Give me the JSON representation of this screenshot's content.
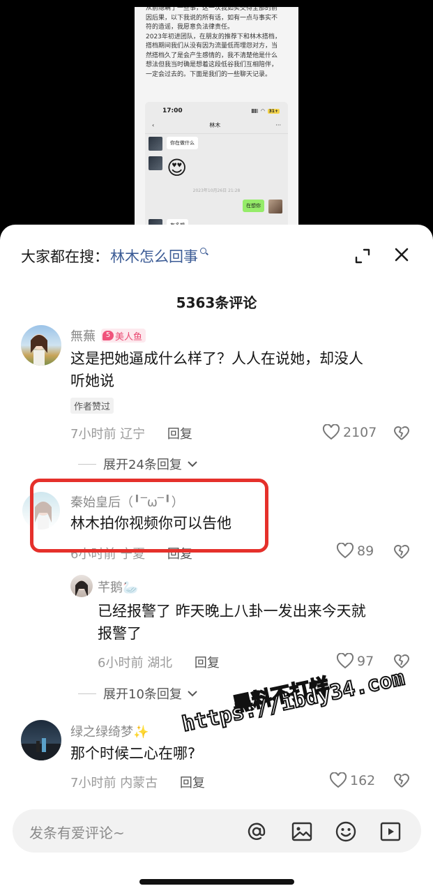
{
  "preview": {
    "doc_lines": [
      "从前隐瞒了一些事，这一次我如实交待全部的前",
      "因后果，以下我说的所有话，如有一点与事实不",
      "符的造谣，我愿意负法律责任。",
      "2023年初进团队，在朋友的推荐下和林木搭档，",
      "搭档期间我们从没有因为流量低而埋怨对方，当",
      "然搭档久了是会产生感情的，我不清楚他是什么",
      "想法但我当时确是想着这段低谷我们互相陪伴，",
      "一定会过去的。下面是我们的一些聊天记录。"
    ],
    "chat": {
      "status_time": "17:00",
      "battery": "31+",
      "contact": "林木",
      "more": "···",
      "msg1": "你在做什么",
      "timestamp": "2023年10月26日 21:28",
      "msg_me": "在想你",
      "msg3": "有多想"
    }
  },
  "sheet": {
    "hot_search_prefix": "大家都在搜：",
    "hot_search_term": "林木怎么回事",
    "comment_count": "5363条评论"
  },
  "comments": [
    {
      "user": "無蕪",
      "badge_level": "5",
      "badge_text": "美人鱼",
      "text_line1": "这是把她逼成什么样了？人人在说她，却没人",
      "text_line2": "听她说",
      "author_liked": "作者赞过",
      "time": "7小时前",
      "location": "辽宁",
      "reply": "回复",
      "likes": "2107",
      "expand": "展开24条回复"
    },
    {
      "user": "秦始皇后（ ͡° ͜ʖ ͡°）",
      "user_display": "秦始皇后（╹‾ω‾╹）",
      "text": "林木拍你视频你可以告他",
      "time": "6小时前",
      "location": "宁夏",
      "reply": "回复",
      "likes": "89"
    },
    {
      "user": "芊鹅🦢",
      "text_line1": "已经报警了 昨天晚上八卦一发出来今天就",
      "text_line2": "报警了",
      "time": "6小时前",
      "location": "湖北",
      "reply": "回复",
      "likes": "97",
      "expand": "展开10条回复"
    },
    {
      "user": "绿之绿绮梦✨",
      "text": "那个时候二心在哪?",
      "time": "7小时前",
      "location": "内蒙古",
      "reply": "回复",
      "likes": "162"
    }
  ],
  "watermark": {
    "line1": "黑料不打烊",
    "line2": "https://ibdy34.com"
  },
  "input": {
    "placeholder": "发条有爱评论~"
  },
  "colors": {
    "accent_link": "#3b5b95",
    "highlight_box": "#e5302b",
    "badge": "#f0527b"
  }
}
